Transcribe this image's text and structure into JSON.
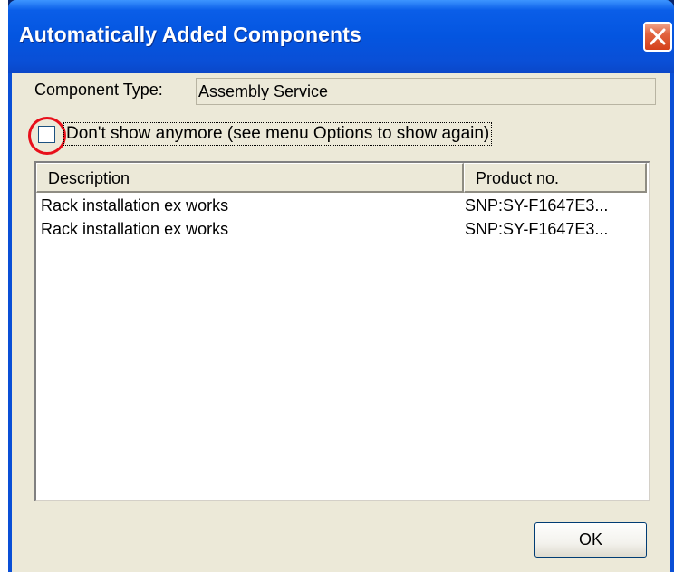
{
  "window": {
    "title": "Automatically Added Components"
  },
  "component_type": {
    "label": "Component Type:",
    "value": "Assembly Service"
  },
  "dont_show": {
    "label": "Don't show anymore (see menu Options to show again)",
    "checked": false
  },
  "list": {
    "columns": [
      "Description",
      "Product no."
    ],
    "rows": [
      {
        "description": "Rack installation ex works",
        "product_no": "SNP:SY-F1647E3..."
      },
      {
        "description": "Rack installation ex works",
        "product_no": "SNP:SY-F1647E3..."
      }
    ]
  },
  "buttons": {
    "ok": "OK"
  },
  "colors": {
    "titlebar": "#0455e0",
    "dialog_bg": "#ece9d8",
    "highlight_circle": "#e8101b",
    "close_button": "#d4401c"
  },
  "icons": {
    "close": "close-icon"
  }
}
